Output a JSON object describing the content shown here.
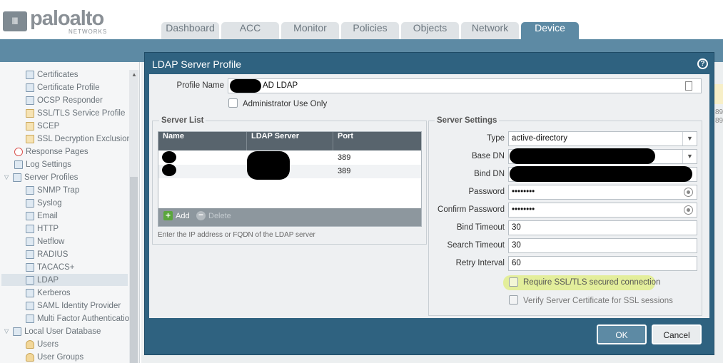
{
  "app": {
    "logo_main": "paloalto",
    "logo_sub": "NETWORKS"
  },
  "tabs": [
    {
      "label": "Dashboard"
    },
    {
      "label": "ACC"
    },
    {
      "label": "Monitor"
    },
    {
      "label": "Policies"
    },
    {
      "label": "Objects"
    },
    {
      "label": "Network"
    },
    {
      "label": "Device"
    }
  ],
  "active_tab": "Device",
  "sidebar": {
    "items": [
      {
        "label": "Certificates",
        "icon": "certificate-icon"
      },
      {
        "label": "Certificate Profile",
        "icon": "certificate-profile-icon"
      },
      {
        "label": "OCSP Responder",
        "icon": "ocsp-icon"
      },
      {
        "label": "SSL/TLS Service Profile",
        "icon": "lock-icon"
      },
      {
        "label": "SCEP",
        "icon": "lock-icon"
      },
      {
        "label": "SSL Decryption Exclusion",
        "icon": "lock-icon"
      },
      {
        "label": "Response Pages",
        "icon": "no-entry-icon"
      },
      {
        "label": "Log Settings",
        "icon": "log-icon"
      },
      {
        "label": "Server Profiles",
        "icon": "server-profiles-icon"
      },
      {
        "label": "SNMP Trap",
        "icon": "snmp-icon"
      },
      {
        "label": "Syslog",
        "icon": "syslog-icon"
      },
      {
        "label": "Email",
        "icon": "email-icon"
      },
      {
        "label": "HTTP",
        "icon": "http-icon"
      },
      {
        "label": "Netflow",
        "icon": "netflow-icon"
      },
      {
        "label": "RADIUS",
        "icon": "radius-icon"
      },
      {
        "label": "TACACS+",
        "icon": "tacacs-icon"
      },
      {
        "label": "LDAP",
        "icon": "ldap-icon"
      },
      {
        "label": "Kerberos",
        "icon": "kerberos-icon"
      },
      {
        "label": "SAML Identity Provider",
        "icon": "saml-icon"
      },
      {
        "label": "Multi Factor Authentication",
        "icon": "mfa-icon"
      },
      {
        "label": "Local User Database",
        "icon": "database-icon"
      },
      {
        "label": "Users",
        "icon": "user-icon"
      },
      {
        "label": "User Groups",
        "icon": "user-group-icon"
      }
    ]
  },
  "right_numbers": [
    "89",
    "89"
  ],
  "dialog": {
    "title": "LDAP Server Profile",
    "help": "?",
    "profile_name_label": "Profile Name",
    "profile_name_value": "AD LDAP",
    "admin_only_label": "Administrator Use Only",
    "server_list": {
      "legend": "Server List",
      "columns": [
        "Name",
        "LDAP Server",
        "Port"
      ],
      "rows": [
        {
          "port": "389"
        },
        {
          "port": "389"
        }
      ],
      "add_label": "Add",
      "delete_label": "Delete",
      "hint": "Enter the IP address or FQDN of the LDAP server"
    },
    "server_settings": {
      "legend": "Server Settings",
      "type_label": "Type",
      "type_value": "active-directory",
      "base_dn_label": "Base DN",
      "bind_dn_label": "Bind DN",
      "password_label": "Password",
      "password_value": "••••••••",
      "confirm_password_label": "Confirm Password",
      "confirm_password_value": "••••••••",
      "bind_timeout_label": "Bind Timeout",
      "bind_timeout_value": "30",
      "search_timeout_label": "Search Timeout",
      "search_timeout_value": "30",
      "retry_interval_label": "Retry Interval",
      "retry_interval_value": "60",
      "require_ssl_label": "Require SSL/TLS secured connection",
      "verify_cert_label": "Verify Server Certificate for SSL sessions"
    },
    "ok_label": "OK",
    "cancel_label": "Cancel"
  },
  "colors": {
    "brand_blue": "#5d8aa4",
    "dialog_frame": "#2f6280",
    "grid_header": "#58646d",
    "highlight": "#e3ee9b"
  }
}
